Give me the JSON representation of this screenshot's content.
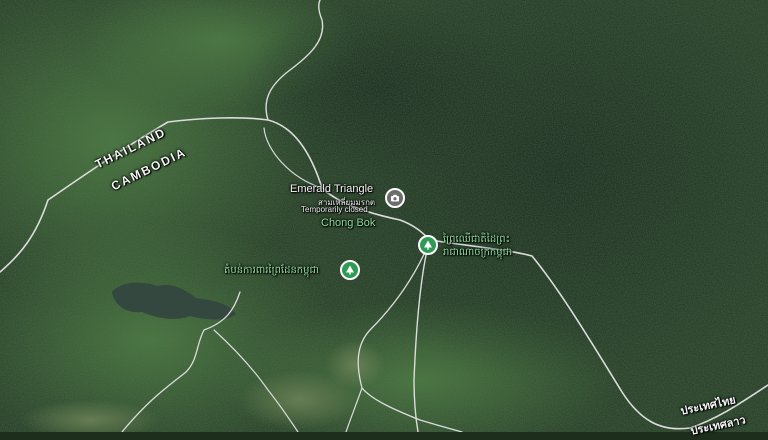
{
  "map": {
    "type": "satellite",
    "colors": {
      "forest_dark": "#1f321f",
      "forest_mid": "#2c4a2c",
      "forest_light": "#3d6b36",
      "road": "#d9d9d9",
      "water": "#3a4d4a",
      "park_pin": "#2e9a54",
      "landmark_pin": "#6c6c6c",
      "park_label": "#8fdc9d"
    }
  },
  "labels": {
    "thailand": "THAILAND",
    "cambodia": "CAMBODIA",
    "emerald_name": "Emerald Triangle",
    "emerald_thai": "สามเหลี่ยมมรกต",
    "emerald_status": "Temporarily closed",
    "chong_bok": "Chong Bok",
    "park_right_line1": "ព្រៃឈើជាតិដៃព្រះ",
    "park_right_line2": "រាជាណាចក្រកម្ពុជា",
    "park_left": "តំបន់ការពារព្រៃដែនកម្ពុជា",
    "thailand_local": "ประเทศไทย",
    "laos_local": "ประเทศลาว"
  },
  "icons": {
    "emerald_pin": "camera-icon",
    "park_right_pin": "tree-icon",
    "park_left_pin": "tree-icon"
  }
}
